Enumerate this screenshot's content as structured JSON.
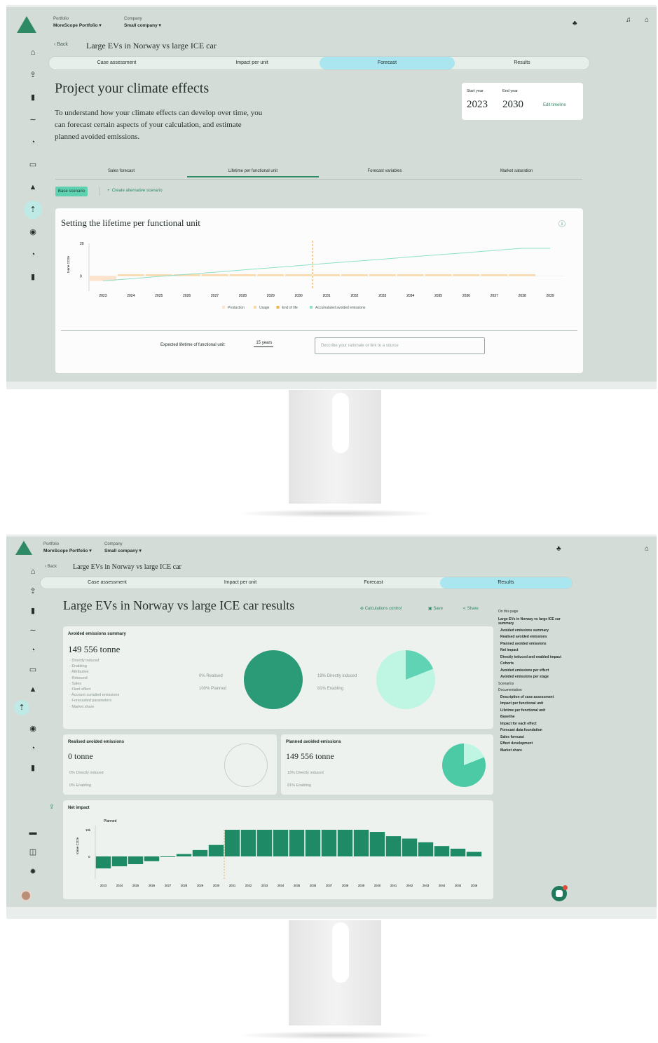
{
  "portfolio": {
    "label": "Portfolio",
    "value": "MoreScope Portfolio"
  },
  "company": {
    "label": "Company",
    "value": "Small company"
  },
  "back_label": "Back",
  "case_title": "Large EVs in Norway vs large ICE car",
  "tabs": [
    "Case assessment",
    "Impact per unit",
    "Forecast",
    "Results"
  ],
  "forecast": {
    "title": "Project your climate effects",
    "description": "To understand how your climate effects can develop over time, you can forecast certain aspects of your calculation, and estimate planned avoided emissions.",
    "start_year_label": "Start year",
    "start_year": "2023",
    "end_year_label": "End year",
    "end_year": "2030",
    "edit_timeline": "Edit timeline",
    "subtabs": [
      "Sales forecast",
      "Lifetime per functional unit",
      "Forecast variables",
      "Market saturation"
    ],
    "base_scenario": "Base scenario",
    "create_alt": "Create alternative scenario",
    "card_title": "Setting the lifetime per functional unit",
    "lifetime_label": "Expected lifetime of functional unit:",
    "lifetime_value": "15",
    "lifetime_unit": "years",
    "rationale_placeholder": "Describe your rationale or link to a source"
  },
  "results": {
    "title": "Large EVs in Norway vs large ICE car results",
    "actions": [
      "Calculations control",
      "Save",
      "Share"
    ],
    "summary_title": "Avoided emissions summary",
    "summary_value": "149 556 tonne",
    "summary_items": [
      "Directly induced",
      "Enabling",
      "Attributive",
      "Rebound",
      "Sales",
      "Fleet effect",
      "Account curtailed emissions",
      "Forecasted parameters",
      "Market share"
    ],
    "realised_label": "Realised",
    "realised_pct": "0%",
    "planned_label": "Planned",
    "planned_pct": "100%",
    "direct_label": "Directly induced",
    "direct_pct": "19%",
    "enabling_label": "Enabling",
    "enabling_pct": "81%",
    "realised_title": "Realised avoided emissions",
    "realised_value": "0 tonne",
    "realised_direct": "0%",
    "realised_enabling": "0%",
    "planned_title": "Planned avoided emissions",
    "planned_value": "149 556 tonne",
    "planned_direct": "19%",
    "planned_enabling": "81%",
    "net_title": "Net impact",
    "net_legend": "Planned",
    "on_this_page": "On this page",
    "toc": [
      "Large EVs in Norway vs large ICE car summary",
      "Avoided emissions summary",
      "Realised avoided emissions",
      "Planned avoided emissions",
      "Net impact",
      "Directly induced and enabled impact",
      "Cohorts",
      "Avoided emissions per effect",
      "Avoided emissions per stage",
      "Scenarios",
      "Documentation",
      "Description of case assessment",
      "Impact per functional unit",
      "Lifetime per functional unit",
      "Baseline",
      "Impact for each effect",
      "Forecast data foundation",
      "Sales forecast",
      "Effect development",
      "Market share"
    ]
  },
  "chart_data": [
    {
      "type": "line",
      "title": "Setting the lifetime per functional unit",
      "ylabel": "tonne CO2e",
      "ylim": [
        -5,
        20
      ],
      "yticks": [
        20,
        0
      ],
      "x": [
        "2023",
        "2024",
        "2025",
        "2026",
        "2027",
        "2028",
        "2029",
        "2030",
        "2031",
        "2032",
        "2033",
        "2034",
        "2035",
        "2036",
        "2037",
        "2038",
        "2039"
      ],
      "series": [
        {
          "name": "Production",
          "kind": "bar",
          "color": "#fde2cc",
          "values": [
            -3,
            0,
            0,
            0,
            0,
            0,
            0,
            0,
            0,
            0,
            0,
            0,
            0,
            0,
            0,
            0,
            0
          ]
        },
        {
          "name": "Usage",
          "kind": "bar",
          "color": "#fbd7a6",
          "values": [
            0,
            1,
            1,
            1,
            1,
            1,
            1,
            1,
            1,
            1,
            1,
            1,
            1,
            1,
            1,
            1,
            0
          ]
        },
        {
          "name": "End of life",
          "kind": "bar",
          "color": "#f6b04a",
          "values": [
            0,
            0,
            0,
            0,
            0,
            0,
            0,
            0,
            0,
            0,
            0,
            0,
            0,
            0,
            0,
            0,
            0
          ]
        },
        {
          "name": "Accumulated avoided emissions",
          "kind": "line",
          "color": "#8fe0c6",
          "values": [
            -3,
            -1.7,
            -0.3,
            1,
            2.3,
            3.7,
            5,
            6.3,
            7.7,
            9,
            10.3,
            11.7,
            13,
            14.3,
            15.7,
            17,
            17
          ]
        }
      ],
      "marker_year": "2030",
      "legend": "bottom"
    },
    {
      "type": "bar",
      "title": "Net impact",
      "ylabel": "tonne CO2e",
      "yticks": [
        "10k",
        "0"
      ],
      "series_name": "Planned",
      "x": [
        "2023",
        "2024",
        "2025",
        "2026",
        "2027",
        "2028",
        "2029",
        "2030",
        "2031",
        "2032",
        "2033",
        "2034",
        "2035",
        "2036",
        "2037",
        "2038",
        "2039",
        "2040",
        "2041",
        "2042",
        "2043",
        "2044",
        "2045",
        "2046"
      ],
      "values": [
        -4500,
        -3700,
        -2900,
        -1800,
        -200,
        900,
        2400,
        4300,
        10000,
        10000,
        10000,
        10000,
        10000,
        10000,
        10000,
        10000,
        10000,
        9200,
        7600,
        6700,
        5300,
        3900,
        2900,
        1700
      ],
      "marker_year": "2030"
    }
  ]
}
